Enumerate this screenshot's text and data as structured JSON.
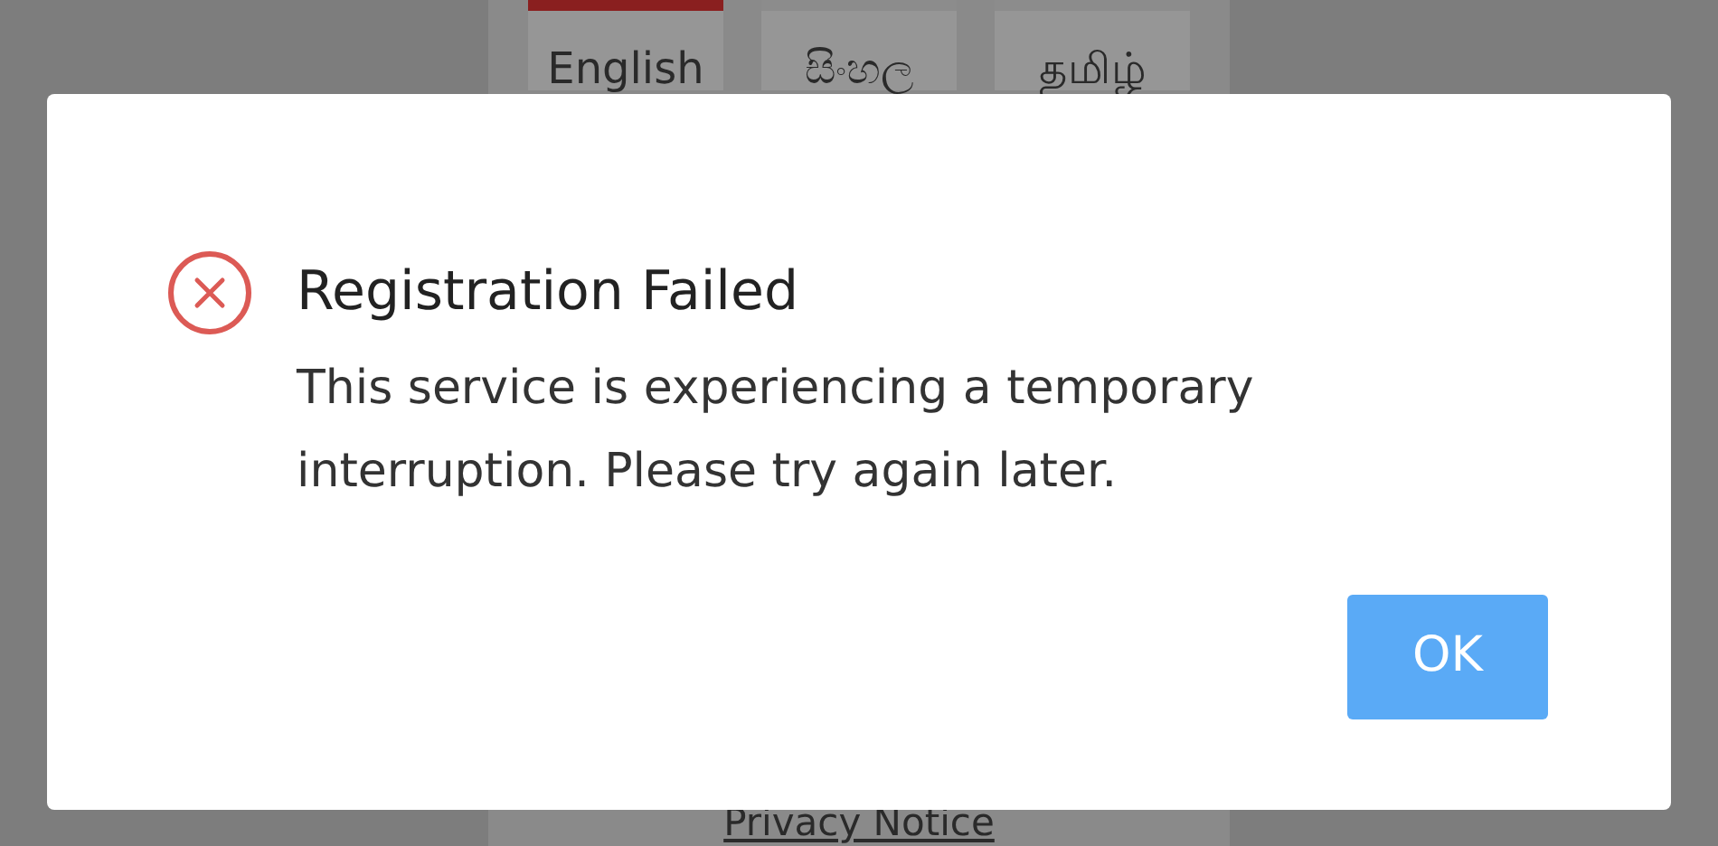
{
  "language_tabs": [
    {
      "label": "English",
      "selected": true
    },
    {
      "label": "සිංහල",
      "selected": false
    },
    {
      "label": "தமிழ்",
      "selected": false
    }
  ],
  "privacy_link": "Privacy Notice",
  "dialog": {
    "title": "Registration Failed",
    "message": "This service is experiencing a temporary interruption. Please try again later.",
    "button": "OK"
  }
}
